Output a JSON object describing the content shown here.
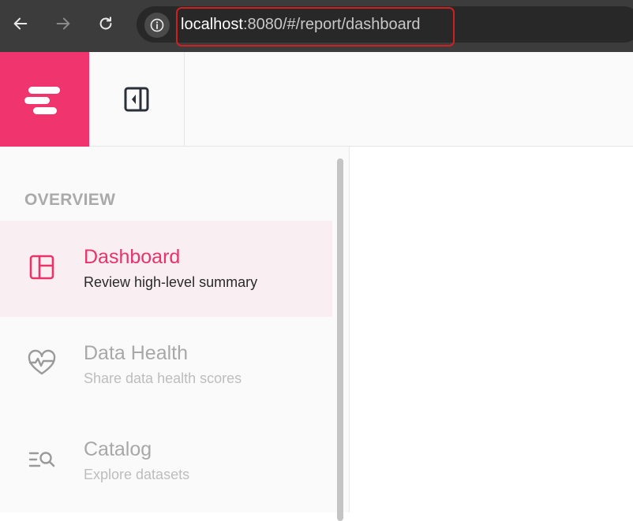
{
  "browser": {
    "url_host": "localhost",
    "url_rest": ":8080/#/report/dashboard"
  },
  "app": {
    "brand_color": "#f0346e"
  },
  "sidebar": {
    "section_label": "OVERVIEW",
    "items": [
      {
        "title": "Dashboard",
        "subtitle": "Review high-level summary",
        "icon": "dashboard-layout-icon",
        "active": true
      },
      {
        "title": "Data Health",
        "subtitle": "Share data health scores",
        "icon": "heart-pulse-icon",
        "active": false
      },
      {
        "title": "Catalog",
        "subtitle": "Explore datasets",
        "icon": "list-search-icon",
        "active": false
      }
    ]
  }
}
